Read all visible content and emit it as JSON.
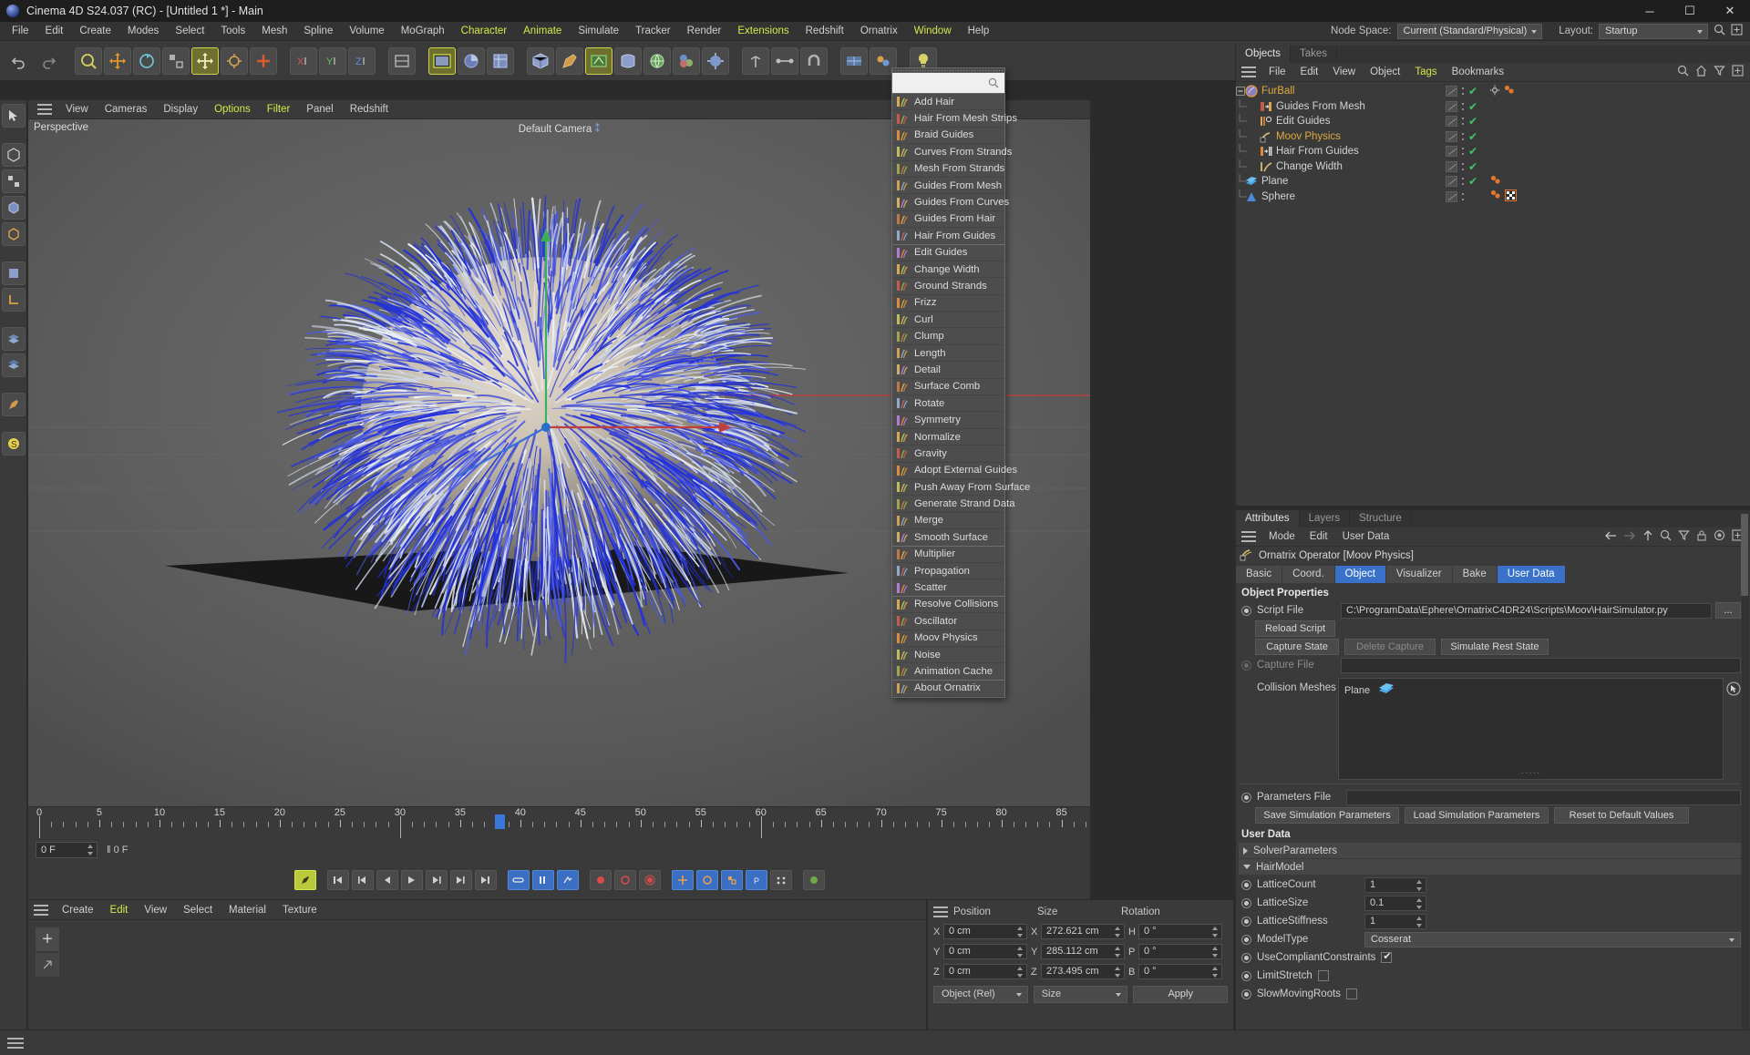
{
  "window": {
    "title": "Cinema 4D S24.037 (RC) - [Untitled 1 *] - Main",
    "minimize": "─",
    "maximize": "☐",
    "close": "✕"
  },
  "menubar": {
    "items": [
      {
        "label": "File",
        "hl": false
      },
      {
        "label": "Edit",
        "hl": false
      },
      {
        "label": "Create",
        "hl": false
      },
      {
        "label": "Modes",
        "hl": false
      },
      {
        "label": "Select",
        "hl": false
      },
      {
        "label": "Tools",
        "hl": false
      },
      {
        "label": "Mesh",
        "hl": false
      },
      {
        "label": "Spline",
        "hl": false
      },
      {
        "label": "Volume",
        "hl": false
      },
      {
        "label": "MoGraph",
        "hl": false
      },
      {
        "label": "Character",
        "hl": true
      },
      {
        "label": "Animate",
        "hl": true
      },
      {
        "label": "Simulate",
        "hl": false
      },
      {
        "label": "Tracker",
        "hl": false
      },
      {
        "label": "Render",
        "hl": false
      },
      {
        "label": "Extensions",
        "hl": true
      },
      {
        "label": "Redshift",
        "hl": false
      },
      {
        "label": "Ornatrix",
        "hl": false
      },
      {
        "label": "Window",
        "hl": true
      },
      {
        "label": "Help",
        "hl": false
      }
    ],
    "node_space_label": "Node Space:",
    "node_space_value": "Current (Standard/Physical)",
    "layout_label": "Layout:",
    "layout_value": "Startup",
    "search_icon": "search-icon"
  },
  "viewport": {
    "menu": [
      {
        "label": "View",
        "hl": false
      },
      {
        "label": "Cameras",
        "hl": false
      },
      {
        "label": "Display",
        "hl": false
      },
      {
        "label": "Options",
        "hl": true
      },
      {
        "label": "Filter",
        "hl": true
      },
      {
        "label": "Panel",
        "hl": false
      },
      {
        "label": "Redshift",
        "hl": false
      }
    ],
    "projection_label": "Perspective",
    "camera_label": "Default Camera"
  },
  "ornatrix_menu": {
    "search_value": "",
    "items": [
      {
        "label": "Add Hair",
        "icon": "add-hair-icon",
        "sep": false
      },
      {
        "label": "Hair From Mesh Strips",
        "icon": "hair-from-mesh-strips-icon",
        "sep": false
      },
      {
        "label": "Braid Guides",
        "icon": "braid-guides-icon",
        "sep": false
      },
      {
        "label": "Curves From Strands",
        "icon": "curves-from-strands-icon",
        "sep": false
      },
      {
        "label": "Mesh From Strands",
        "icon": "mesh-from-strands-icon",
        "sep": false
      },
      {
        "label": "Guides From Mesh",
        "icon": "guides-from-mesh-icon",
        "sep": false
      },
      {
        "label": "Guides From Curves",
        "icon": "guides-from-curves-icon",
        "sep": false
      },
      {
        "label": "Guides From Hair",
        "icon": "guides-from-hair-icon",
        "sep": false
      },
      {
        "label": "Hair From Guides",
        "icon": "hair-from-guides-icon",
        "sep": true
      },
      {
        "label": "Edit Guides",
        "icon": "edit-guides-icon",
        "sep": false
      },
      {
        "label": "Change Width",
        "icon": "change-width-icon",
        "sep": false
      },
      {
        "label": "Ground Strands",
        "icon": "ground-strands-icon",
        "sep": false
      },
      {
        "label": "Frizz",
        "icon": "frizz-icon",
        "sep": false
      },
      {
        "label": "Curl",
        "icon": "curl-icon",
        "sep": false
      },
      {
        "label": "Clump",
        "icon": "clump-icon",
        "sep": false
      },
      {
        "label": "Length",
        "icon": "length-icon",
        "sep": false
      },
      {
        "label": "Detail",
        "icon": "detail-icon",
        "sep": false
      },
      {
        "label": "Surface Comb",
        "icon": "surface-comb-icon",
        "sep": false
      },
      {
        "label": "Rotate",
        "icon": "rotate-icon",
        "sep": false
      },
      {
        "label": "Symmetry",
        "icon": "symmetry-icon",
        "sep": false
      },
      {
        "label": "Normalize",
        "icon": "normalize-icon",
        "sep": false
      },
      {
        "label": "Gravity",
        "icon": "gravity-icon",
        "sep": false
      },
      {
        "label": "Adopt External Guides",
        "icon": "adopt-external-guides-icon",
        "sep": false
      },
      {
        "label": "Push Away From Surface",
        "icon": "push-away-from-surface-icon",
        "sep": false
      },
      {
        "label": "Generate Strand Data",
        "icon": "generate-strand-data-icon",
        "sep": false
      },
      {
        "label": "Merge",
        "icon": "merge-icon",
        "sep": false
      },
      {
        "label": "Smooth Surface",
        "icon": "smooth-surface-icon",
        "sep": true
      },
      {
        "label": "Multiplier",
        "icon": "multiplier-icon",
        "sep": false
      },
      {
        "label": "Propagation",
        "icon": "propagation-icon",
        "sep": false
      },
      {
        "label": "Scatter",
        "icon": "scatter-icon",
        "sep": true
      },
      {
        "label": "Resolve Collisions",
        "icon": "resolve-collisions-icon",
        "sep": false
      },
      {
        "label": "Oscillator",
        "icon": "oscillator-icon",
        "sep": false
      },
      {
        "label": "Moov Physics",
        "icon": "moov-physics-icon",
        "sep": false
      },
      {
        "label": "Noise",
        "icon": "noise-icon",
        "sep": false
      },
      {
        "label": "Animation Cache",
        "icon": "animation-cache-icon",
        "sep": true
      },
      {
        "label": "About Ornatrix",
        "icon": "about-ornatrix-icon",
        "sep": false
      }
    ]
  },
  "timeline": {
    "ticks": [
      0,
      5,
      10,
      15,
      20,
      25,
      30,
      35,
      40,
      45,
      50,
      55,
      60,
      65,
      70,
      75,
      80,
      85
    ],
    "current_frame": "0 F",
    "playhead_frame": 38,
    "readout": "0 F",
    "range_start": 0,
    "range_end": 87
  },
  "object_manager": {
    "tabs": [
      {
        "label": "Objects",
        "sel": true
      },
      {
        "label": "Takes",
        "sel": false
      }
    ],
    "menu": [
      {
        "label": "File",
        "hl": false
      },
      {
        "label": "Edit",
        "hl": false
      },
      {
        "label": "View",
        "hl": false
      },
      {
        "label": "Object",
        "hl": false
      },
      {
        "label": "Tags",
        "hl": true
      },
      {
        "label": "Bookmarks",
        "hl": false
      }
    ],
    "tools": [
      "search-icon",
      "home-icon",
      "filter-icon",
      "add-icon"
    ],
    "rows": [
      {
        "label": "FurBall",
        "icon": "furball-icon",
        "depth": 0,
        "color": "orange",
        "expander": true,
        "check": true,
        "tags": [
          "gear-tag",
          "ornatrix-tag"
        ]
      },
      {
        "label": "Guides From Mesh",
        "icon": "guides-from-mesh-icon",
        "depth": 1,
        "color": "normal",
        "expander": false,
        "check": true,
        "tags": []
      },
      {
        "label": "Edit Guides",
        "icon": "edit-guides-icon",
        "depth": 1,
        "color": "normal",
        "expander": false,
        "check": true,
        "tags": []
      },
      {
        "label": "Moov Physics",
        "icon": "moov-physics-icon",
        "depth": 1,
        "color": "orange",
        "expander": false,
        "check": true,
        "tags": []
      },
      {
        "label": "Hair From Guides",
        "icon": "hair-from-guides-icon",
        "depth": 1,
        "color": "normal",
        "expander": false,
        "check": true,
        "tags": []
      },
      {
        "label": "Change Width",
        "icon": "change-width-icon",
        "depth": 1,
        "color": "normal",
        "expander": false,
        "check": true,
        "tags": []
      },
      {
        "label": "Plane",
        "icon": "plane-icon",
        "depth": 0,
        "color": "normal",
        "expander": false,
        "check": true,
        "tags": [
          "ornatrix-tag"
        ]
      },
      {
        "label": "Sphere",
        "icon": "sphere-icon",
        "depth": 0,
        "color": "normal",
        "expander": false,
        "check": false,
        "tags": [
          "ornatrix-tag",
          "texture-tag"
        ]
      }
    ]
  },
  "attributes": {
    "tabs": [
      {
        "label": "Attributes",
        "sel": true
      },
      {
        "label": "Layers",
        "sel": false
      },
      {
        "label": "Structure",
        "sel": false
      }
    ],
    "menu": [
      {
        "label": "Mode"
      },
      {
        "label": "Edit"
      },
      {
        "label": "User Data"
      }
    ],
    "tools": [
      "back-arrow-icon",
      "forward-arrow-icon",
      "up-arrow-icon",
      "search-icon",
      "filter-icon",
      "lock-icon",
      "target-icon",
      "add-icon"
    ],
    "header": "Ornatrix Operator [Moov Physics]",
    "obj_tabs": [
      {
        "label": "Basic",
        "sel": false
      },
      {
        "label": "Coord.",
        "sel": false
      },
      {
        "label": "Object",
        "sel": true
      },
      {
        "label": "Visualizer",
        "sel": false
      },
      {
        "label": "Bake",
        "sel": false
      },
      {
        "label": "User Data",
        "sel": true
      }
    ],
    "object_properties_title": "Object Properties",
    "script_file_label": "Script File",
    "script_file_value": "C:\\ProgramData\\Ephere\\OrnatrixC4DR24\\Scripts\\Moov\\HairSimulator.py",
    "browse_label": "...",
    "reload_script_label": "Reload Script",
    "capture_state_label": "Capture State",
    "delete_capture_label": "Delete Capture",
    "simulate_rest_state_label": "Simulate Rest State",
    "capture_file_label": "Capture File",
    "capture_file_value": "",
    "collision_meshes_label": "Collision Meshes",
    "collision_meshes_items": [
      {
        "label": "Plane",
        "icon": "plane-icon"
      }
    ],
    "parameters_file_label": "Parameters File",
    "parameters_file_value": "",
    "save_sim_params_label": "Save Simulation Parameters",
    "load_sim_params_label": "Load Simulation Parameters",
    "reset_defaults_label": "Reset to Default Values",
    "user_data_title": "User Data",
    "groups": [
      {
        "label": "SolverParameters",
        "expanded": false
      },
      {
        "label": "HairModel",
        "expanded": true
      }
    ],
    "fields": [
      {
        "label": "LatticeCount",
        "type": "number",
        "value": "1"
      },
      {
        "label": "LatticeSize",
        "type": "number",
        "value": "0.1"
      },
      {
        "label": "LatticeStiffness",
        "type": "number",
        "value": "1"
      },
      {
        "label": "ModelType",
        "type": "select",
        "value": "Cosserat"
      },
      {
        "label": "UseCompliantConstraints",
        "type": "checkbox",
        "value": true
      },
      {
        "label": "LimitStretch",
        "type": "checkbox",
        "value": false
      },
      {
        "label": "SlowMovingRoots",
        "type": "checkbox",
        "value": false
      }
    ]
  },
  "material_manager": {
    "menu": [
      {
        "label": "Create",
        "hl": false
      },
      {
        "label": "Edit",
        "hl": true
      },
      {
        "label": "View",
        "hl": false
      },
      {
        "label": "Select",
        "hl": false
      },
      {
        "label": "Material",
        "hl": false
      },
      {
        "label": "Texture",
        "hl": false
      }
    ],
    "new_material_label": "+"
  },
  "coordinates": {
    "columns": [
      "Position",
      "Size",
      "Rotation"
    ],
    "position": [
      {
        "axis": "X",
        "value": "0 cm"
      },
      {
        "axis": "Y",
        "value": "0 cm"
      },
      {
        "axis": "Z",
        "value": "0 cm"
      }
    ],
    "size": [
      {
        "axis": "X",
        "value": "272.621 cm"
      },
      {
        "axis": "Y",
        "value": "285.112 cm"
      },
      {
        "axis": "Z",
        "value": "273.495 cm"
      }
    ],
    "rotation": [
      {
        "axis": "H",
        "value": "0 °"
      },
      {
        "axis": "P",
        "value": "0 °"
      },
      {
        "axis": "B",
        "value": "0 °"
      }
    ],
    "mode_value": "Object (Rel)",
    "size_value": "Size",
    "apply_label": "Apply"
  },
  "colors": {
    "accent_blue": "#3b72c9",
    "accent_yellow": "#d6e84a",
    "panel_bg": "#3a3a3a",
    "field_bg": "#2e2e2e",
    "orange_text": "#e0a93f",
    "check_green": "#3ec46d",
    "hair_blue": "#2b3fe0",
    "hair_light": "#c9d6e8"
  }
}
